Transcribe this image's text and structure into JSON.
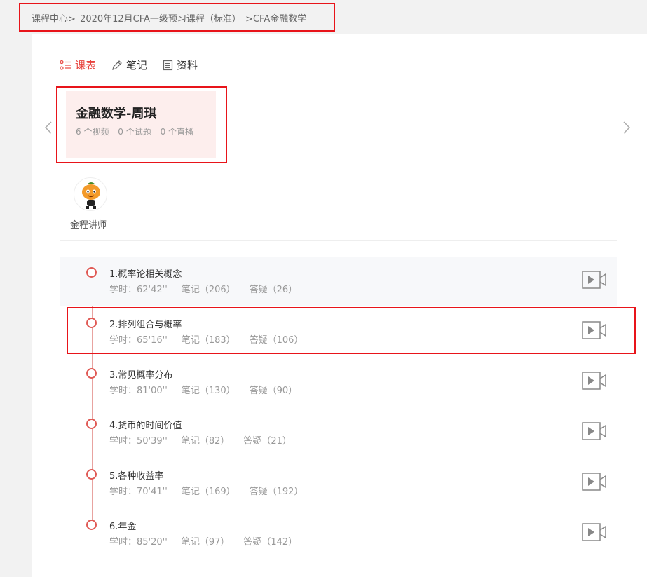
{
  "breadcrumb": {
    "home": "课程中心>",
    "course": "2020年12月CFA一级预习课程（标准）",
    "current": ">CFA金融数学"
  },
  "tabs": [
    {
      "label": "课表",
      "icon": "list-icon",
      "active": true
    },
    {
      "label": "笔记",
      "icon": "pencil-icon",
      "active": false
    },
    {
      "label": "资料",
      "icon": "document-icon",
      "active": false
    }
  ],
  "course": {
    "title": "金融数学-周琪",
    "videos": "6 个视频",
    "quizzes": "0 个试题",
    "lives": "0 个直播"
  },
  "teacher": {
    "name": "金程讲师"
  },
  "lessons": [
    {
      "title": "1.概率论相关概念",
      "duration": "学时：62'42''",
      "notes": "笔记（206）",
      "qa": "答疑（26）"
    },
    {
      "title": "2.排列组合与概率",
      "duration": "学时：65'16''",
      "notes": "笔记（183）",
      "qa": "答疑（106）"
    },
    {
      "title": "3.常见概率分布",
      "duration": "学时：81'00''",
      "notes": "笔记（130）",
      "qa": "答疑（90）"
    },
    {
      "title": "4.货币的时间价值",
      "duration": "学时：50'39''",
      "notes": "笔记（82）",
      "qa": "答疑（21）"
    },
    {
      "title": "5.各种收益率",
      "duration": "学时：70'41''",
      "notes": "笔记（169）",
      "qa": "答疑（192）"
    },
    {
      "title": "6.年金",
      "duration": "学时：85'20''",
      "notes": "笔记（97）",
      "qa": "答疑（142）"
    }
  ],
  "colors": {
    "accent": "#e8443f",
    "highlight_border": "#e8141a",
    "card_bg": "#fdeeed"
  }
}
